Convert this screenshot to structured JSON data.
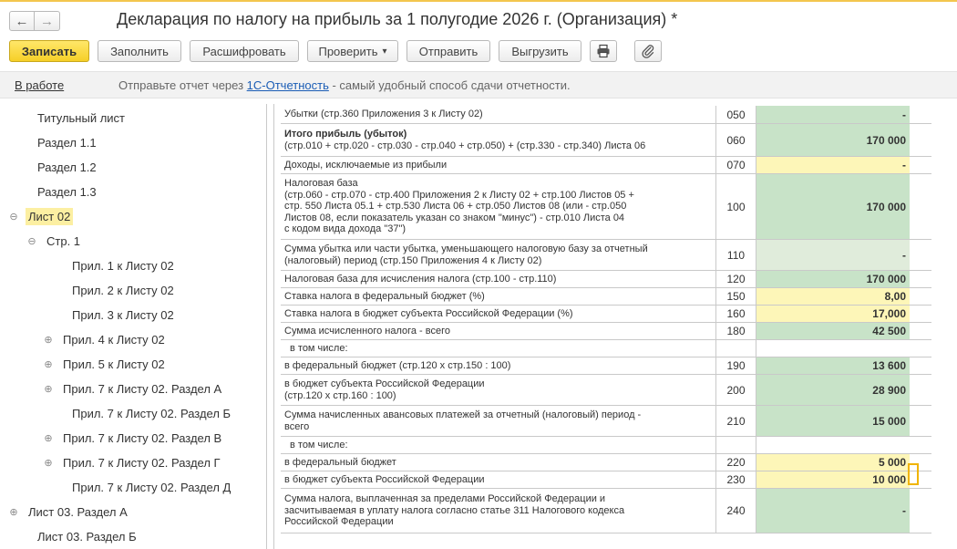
{
  "window": {
    "title": "Декларация по налогу на прибыль за 1 полугодие 2026 г. (Организация) *",
    "nav_back": "←",
    "nav_forward": "→"
  },
  "toolbar": {
    "save": "Записать",
    "fill": "Заполнить",
    "decode": "Расшифровать",
    "check": "Проверить",
    "check_arrow": "▾",
    "send": "Отправить",
    "export": "Выгрузить",
    "print_icon": "printer-icon",
    "attach_icon": "paperclip-icon"
  },
  "status": {
    "state": "В работе",
    "msg_prefix": "Отправьте отчет через ",
    "link": "1С-Отчетность",
    "msg_suffix": " - самый удобный способ сдачи отчетности."
  },
  "tree": [
    {
      "label": "Титульный лист",
      "expander": ""
    },
    {
      "label": "Раздел 1.1",
      "expander": ""
    },
    {
      "label": "Раздел 1.2",
      "expander": ""
    },
    {
      "label": "Раздел 1.3",
      "expander": ""
    },
    {
      "label": "Лист 02",
      "expander": "⊖"
    },
    {
      "label": "Стр. 1",
      "expander": "⊖"
    },
    {
      "label": "Прил. 1 к Листу 02",
      "expander": ""
    },
    {
      "label": "Прил. 2 к Листу 02",
      "expander": ""
    },
    {
      "label": "Прил. 3 к Листу 02",
      "expander": ""
    },
    {
      "label": "Прил. 4 к Листу 02",
      "expander": "⊕"
    },
    {
      "label": "Прил. 5 к Листу 02",
      "expander": "⊕"
    },
    {
      "label": "Прил. 7 к Листу 02. Раздел А",
      "expander": "⊕"
    },
    {
      "label": "Прил. 7 к Листу 02. Раздел Б",
      "expander": ""
    },
    {
      "label": "Прил. 7 к Листу 02. Раздел В",
      "expander": "⊕"
    },
    {
      "label": "Прил. 7 к Листу 02. Раздел Г",
      "expander": "⊕"
    },
    {
      "label": "Прил. 7 к Листу 02. Раздел Д",
      "expander": ""
    },
    {
      "label": "Лист 03. Раздел А",
      "expander": "⊕"
    },
    {
      "label": "Лист 03. Раздел Б",
      "expander": ""
    }
  ],
  "rows": [
    {
      "desc": "Убытки (стр.360 Приложения 3 к Листу 02)",
      "code": "050",
      "value": "-",
      "fill": "green"
    },
    {
      "desc_bold": "Итого прибыль (убыток)",
      "desc": "(стр.010 + стр.020 - стр.030 - стр.040 + стр.050) + (стр.330 - стр.340) Листа 06",
      "code": "060",
      "value": "170 000",
      "fill": "green"
    },
    {
      "desc": "Доходы, исключаемые из прибыли",
      "code": "070",
      "value": "-",
      "fill": "yellow"
    },
    {
      "desc": "Налоговая база\n(стр.060 - стр.070 - стр.400 Приложения 2 к Листу 02 + стр.100 Листов 05 +\nстр. 550 Листа 05.1 + стр.530 Листа 06 + стр.050 Листов 08 (или - стр.050\nЛистов 08, если показатель указан со знаком \"минус\") - стр.010 Листа 04\nс кодом вида дохода \"37\")",
      "code": "100",
      "value": "170 000",
      "fill": "green"
    },
    {
      "desc": "Сумма убытка или части убытка, уменьшающего налоговую базу за отчетный\n(налоговый) период (стр.150 Приложения 4 к Листу 02)",
      "code": "110",
      "value": "-",
      "fill": "lightgreen"
    },
    {
      "desc": "Налоговая база для исчисления налога (стр.100 - стр.110)",
      "code": "120",
      "value": "170 000",
      "fill": "green"
    },
    {
      "desc": "Ставка налога в федеральный бюджет (%)",
      "code": "150",
      "value": "8,00",
      "fill": "yellow"
    },
    {
      "desc": "Ставка налога в бюджет субъекта Российской Федерации (%)",
      "code": "160",
      "value": "17,000",
      "fill": "yellow"
    },
    {
      "desc": "Сумма исчисленного налога - всего",
      "code": "180",
      "value": "42 500",
      "fill": "green"
    },
    {
      "desc": "в том числе:",
      "code": "",
      "value": "",
      "fill": "none",
      "indent": true
    },
    {
      "desc": "в федеральный бюджет (стр.120 х стр.150 : 100)",
      "code": "190",
      "value": "13 600",
      "fill": "green"
    },
    {
      "desc": "в бюджет субъекта Российской Федерации\n(стр.120 х стр.160 : 100)",
      "code": "200",
      "value": "28 900",
      "fill": "green"
    },
    {
      "desc": "Сумма начисленных авансовых платежей за отчетный (налоговый) период -\nвсего",
      "code": "210",
      "value": "15 000",
      "fill": "green"
    },
    {
      "desc": "в том числе:",
      "code": "",
      "value": "",
      "fill": "none",
      "indent": true
    },
    {
      "desc": "в федеральный бюджет",
      "code": "220",
      "value": "5 000",
      "fill": "yellow"
    },
    {
      "desc": "в бюджет субъекта Российской Федерации",
      "code": "230",
      "value": "10 000",
      "fill": "yellow"
    },
    {
      "desc": "Сумма налога, выплаченная за пределами Российской Федерации и\nзасчитываемая в уплату налога согласно статье 311 Налогового кодекса\nРоссийской Федерации",
      "code": "240",
      "value": "-",
      "fill": "green"
    }
  ],
  "colors": {
    "primary_button": "#f6cf27",
    "selected_tree_item": "#fcefa2",
    "cell_green": "#c8e3c8",
    "cell_yellow": "#fdf6b8",
    "link": "#1a5cb5"
  }
}
